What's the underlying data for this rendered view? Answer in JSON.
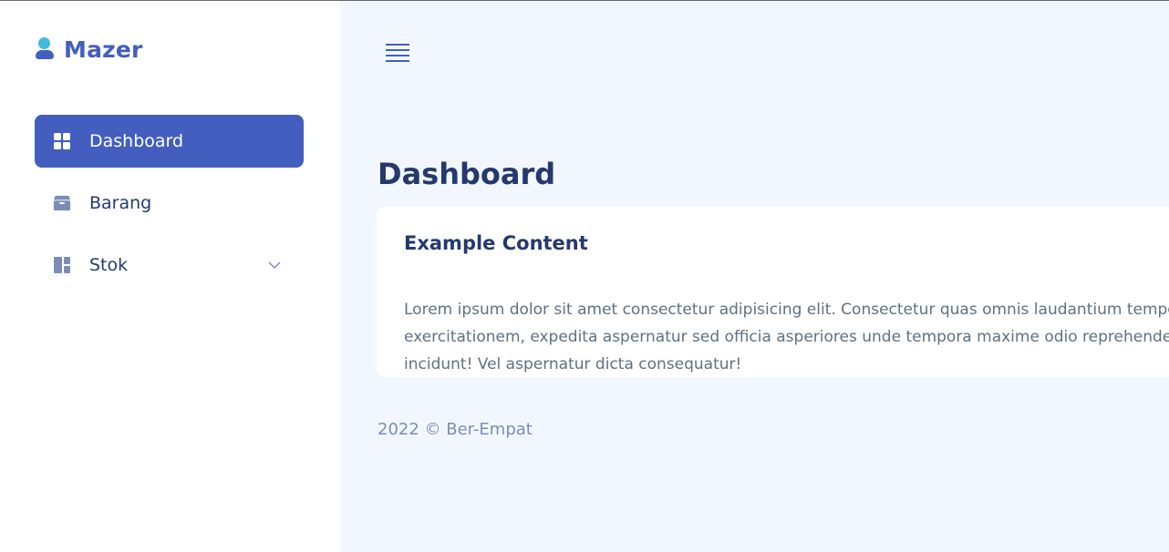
{
  "brand": {
    "name": "Mazer",
    "icon": "person-icon",
    "color": "#435ebe"
  },
  "sidebar": {
    "items": [
      {
        "label": "Dashboard",
        "icon": "grid-icon",
        "active": true
      },
      {
        "label": "Barang",
        "icon": "box-icon",
        "active": false
      },
      {
        "label": "Stok",
        "icon": "layout-icon",
        "active": false,
        "has_submenu": true
      }
    ]
  },
  "header": {
    "menu_icon": "hamburger-icon"
  },
  "page": {
    "title": "Dashboard"
  },
  "card": {
    "title": "Example Content",
    "body": "Lorem ipsum dolor sit amet consectetur adipisicing elit. Consectetur quas omnis laudantium tempore exercitationem, expedita aspernatur sed officia asperiores unde tempora maxime odio reprehenderit distinctio incidunt! Vel aspernatur dicta consequatur!"
  },
  "footer": {
    "text": "2022 © Ber-Empat"
  },
  "colors": {
    "accent": "#435ebe",
    "background": "#f2f7ff",
    "heading": "#25396f"
  }
}
